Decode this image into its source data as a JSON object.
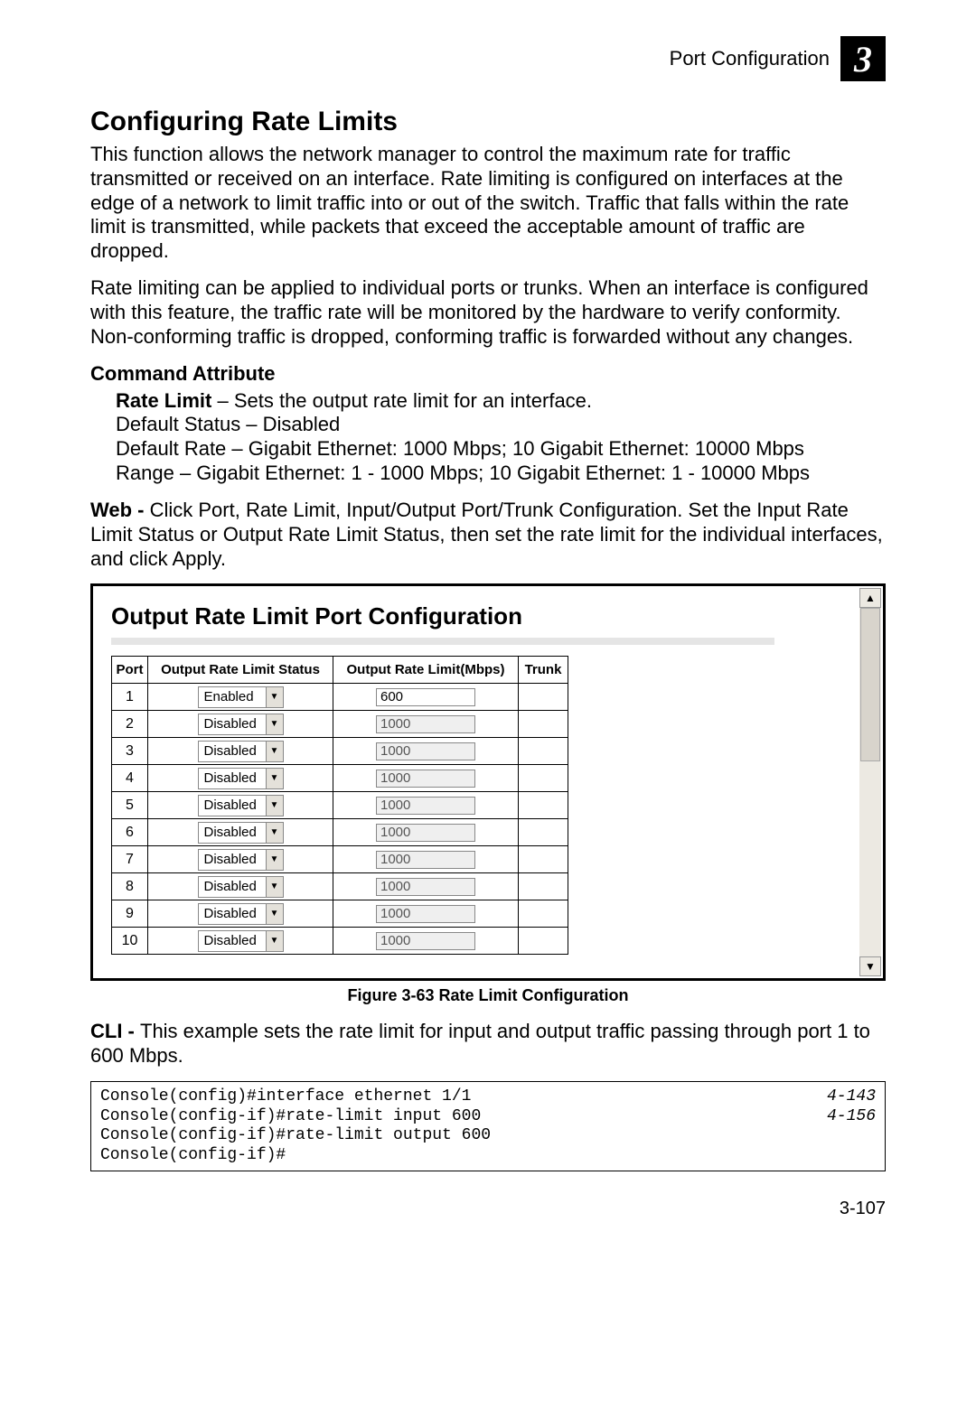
{
  "header": {
    "running_title": "Port Configuration",
    "chapter_number": "3"
  },
  "section": {
    "title": "Configuring Rate Limits",
    "para1": "This function allows the network manager to control the maximum rate for traffic transmitted or received on an interface. Rate limiting is configured on interfaces at the edge of a network to limit traffic into or out of the switch. Traffic that falls within the rate limit is transmitted, while packets that exceed the acceptable amount of traffic are dropped.",
    "para2": "Rate limiting can be applied to individual ports or trunks. When an interface is configured with this feature, the traffic rate will be monitored by the hardware to verify conformity. Non-conforming traffic is dropped, conforming traffic is forwarded without any changes.",
    "cmd_attr_heading": "Command Attribute",
    "cmd_attr_lines": {
      "l1a": "Rate Limit",
      "l1b": " – Sets the output rate limit for an interface.",
      "l2": "Default Status – Disabled",
      "l3": "Default Rate – Gigabit Ethernet: 1000 Mbps; 10 Gigabit Ethernet: 10000 Mbps",
      "l4": "Range – Gigabit Ethernet: 1 - 1000 Mbps; 10 Gigabit Ethernet: 1 - 10000 Mbps"
    },
    "web_lead": "Web - ",
    "web_text": "Click Port, Rate Limit, Input/Output Port/Trunk Configuration. Set the Input Rate Limit Status or Output Rate Limit Status, then set the rate limit for the individual interfaces, and click Apply."
  },
  "screenshot": {
    "title": "Output Rate Limit Port Configuration",
    "columns": {
      "port": "Port",
      "status": "Output Rate Limit Status",
      "rate": "Output Rate Limit(Mbps)",
      "trunk": "Trunk"
    },
    "rows": [
      {
        "port": "1",
        "status": "Enabled",
        "rate": "600",
        "enabled": true,
        "trunk": ""
      },
      {
        "port": "2",
        "status": "Disabled",
        "rate": "1000",
        "enabled": false,
        "trunk": ""
      },
      {
        "port": "3",
        "status": "Disabled",
        "rate": "1000",
        "enabled": false,
        "trunk": ""
      },
      {
        "port": "4",
        "status": "Disabled",
        "rate": "1000",
        "enabled": false,
        "trunk": ""
      },
      {
        "port": "5",
        "status": "Disabled",
        "rate": "1000",
        "enabled": false,
        "trunk": ""
      },
      {
        "port": "6",
        "status": "Disabled",
        "rate": "1000",
        "enabled": false,
        "trunk": ""
      },
      {
        "port": "7",
        "status": "Disabled",
        "rate": "1000",
        "enabled": false,
        "trunk": ""
      },
      {
        "port": "8",
        "status": "Disabled",
        "rate": "1000",
        "enabled": false,
        "trunk": ""
      },
      {
        "port": "9",
        "status": "Disabled",
        "rate": "1000",
        "enabled": false,
        "trunk": ""
      },
      {
        "port": "10",
        "status": "Disabled",
        "rate": "1000",
        "enabled": false,
        "trunk": ""
      }
    ]
  },
  "figure_caption": "Figure 3-63   Rate Limit Configuration",
  "cli": {
    "lead": "CLI - ",
    "text": "This example sets the rate limit for input and output traffic passing through port 1 to 600 Mbps.",
    "lines": [
      {
        "cmd": "Console(config)#interface ethernet 1/1",
        "ref": "4-143"
      },
      {
        "cmd": "Console(config-if)#rate-limit input 600",
        "ref": "4-156"
      },
      {
        "cmd": "Console(config-if)#rate-limit output 600",
        "ref": ""
      },
      {
        "cmd": "Console(config-if)#",
        "ref": ""
      }
    ]
  },
  "page_number": "3-107"
}
